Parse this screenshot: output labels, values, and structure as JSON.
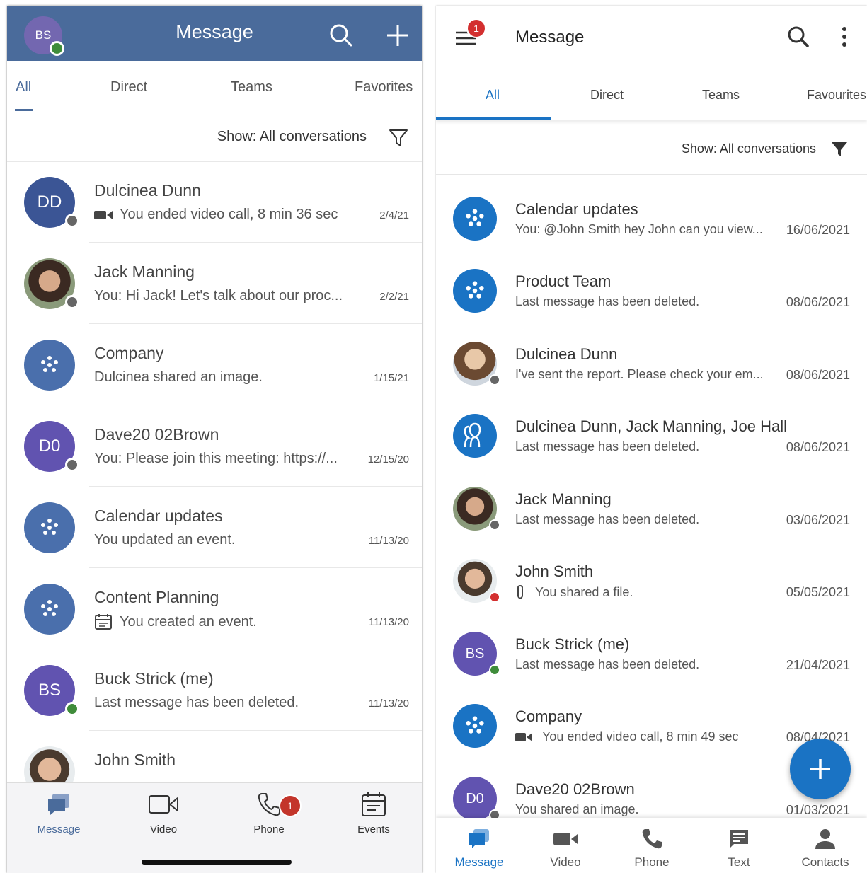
{
  "ios": {
    "header": {
      "title": "Message",
      "avatar_initials": "BS"
    },
    "tabs": [
      "All",
      "Direct",
      "Teams",
      "Favorites"
    ],
    "filter": {
      "label": "Show: All conversations"
    },
    "conversations": [
      {
        "name": "Dulcinea Dunn",
        "preview": "You ended video call, 8 min 36 sec",
        "date": "2/4/21",
        "initials": "DD"
      },
      {
        "name": "Jack Manning",
        "preview": "You: Hi Jack! Let's talk about our proc...",
        "date": "2/2/21"
      },
      {
        "name": "Company",
        "preview": "Dulcinea shared an image.",
        "date": "1/15/21"
      },
      {
        "name": "Dave20 02Brown",
        "preview": "You: Please join this meeting: https://...",
        "date": "12/15/20",
        "initials": "D0"
      },
      {
        "name": "Calendar updates",
        "preview": "You updated an event.",
        "date": "11/13/20"
      },
      {
        "name": "Content Planning",
        "preview": "You created an event.",
        "date": "11/13/20"
      },
      {
        "name": "Buck Strick (me)",
        "preview": "Last message has been deleted.",
        "date": "11/13/20",
        "initials": "BS"
      },
      {
        "name": "John Smith",
        "preview": "",
        "date": ""
      }
    ],
    "bottom_nav": [
      {
        "label": "Message"
      },
      {
        "label": "Video"
      },
      {
        "label": "Phone",
        "badge": "1"
      },
      {
        "label": "Events"
      }
    ],
    "colors": {
      "header": "#4a6b9b",
      "accent": "#4a6b9b",
      "badge": "#c3352b"
    }
  },
  "android": {
    "header": {
      "title": "Message",
      "menu_badge": "1"
    },
    "tabs": [
      "All",
      "Direct",
      "Teams",
      "Favourites"
    ],
    "filter": {
      "label": "Show:  All conversations"
    },
    "conversations": [
      {
        "name": "Calendar updates",
        "preview": "You: @John Smith hey John can you view...",
        "date": "16/06/2021"
      },
      {
        "name": "Product Team",
        "preview": "Last message has been deleted.",
        "date": "08/06/2021"
      },
      {
        "name": "Dulcinea Dunn",
        "preview": "I've sent the report. Please check your em...",
        "date": "08/06/2021"
      },
      {
        "name": "Dulcinea Dunn, Jack Manning, Joe Hall",
        "preview": "Last message has been deleted.",
        "date": "08/06/2021"
      },
      {
        "name": "Jack Manning",
        "preview": "Last message has been deleted.",
        "date": "03/06/2021"
      },
      {
        "name": "John Smith",
        "preview": "You shared a file.",
        "date": "05/05/2021"
      },
      {
        "name": "Buck Strick (me)",
        "preview": "Last message has been deleted.",
        "date": "21/04/2021",
        "initials": "BS"
      },
      {
        "name": "Company",
        "preview": "You ended video call, 8 min 49 sec",
        "date": "08/04/2021"
      },
      {
        "name": "Dave20 02Brown",
        "preview": "You shared an image.",
        "date": "01/03/2021",
        "initials": "D0"
      }
    ],
    "bottom_nav": [
      {
        "label": "Message"
      },
      {
        "label": "Video"
      },
      {
        "label": "Phone"
      },
      {
        "label": "Text"
      },
      {
        "label": "Contacts"
      }
    ],
    "colors": {
      "accent": "#1a73c4",
      "badge": "#d32f2f"
    }
  }
}
